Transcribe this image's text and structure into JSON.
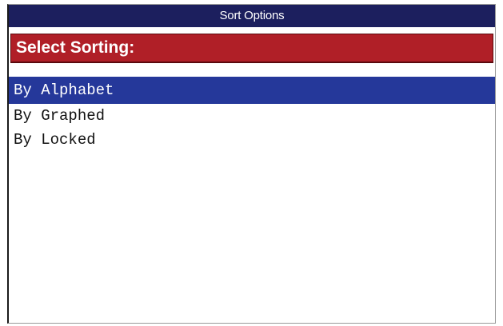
{
  "window": {
    "title": "Sort Options"
  },
  "section": {
    "header": "Select Sorting:"
  },
  "list": {
    "selected_index": 0,
    "items": [
      {
        "label": "By Alphabet"
      },
      {
        "label": "By Graphed"
      },
      {
        "label": "By Locked"
      }
    ]
  },
  "colors": {
    "title_bar": "#1c1f5e",
    "section_header": "#b01f27",
    "selection": "#25389a"
  }
}
